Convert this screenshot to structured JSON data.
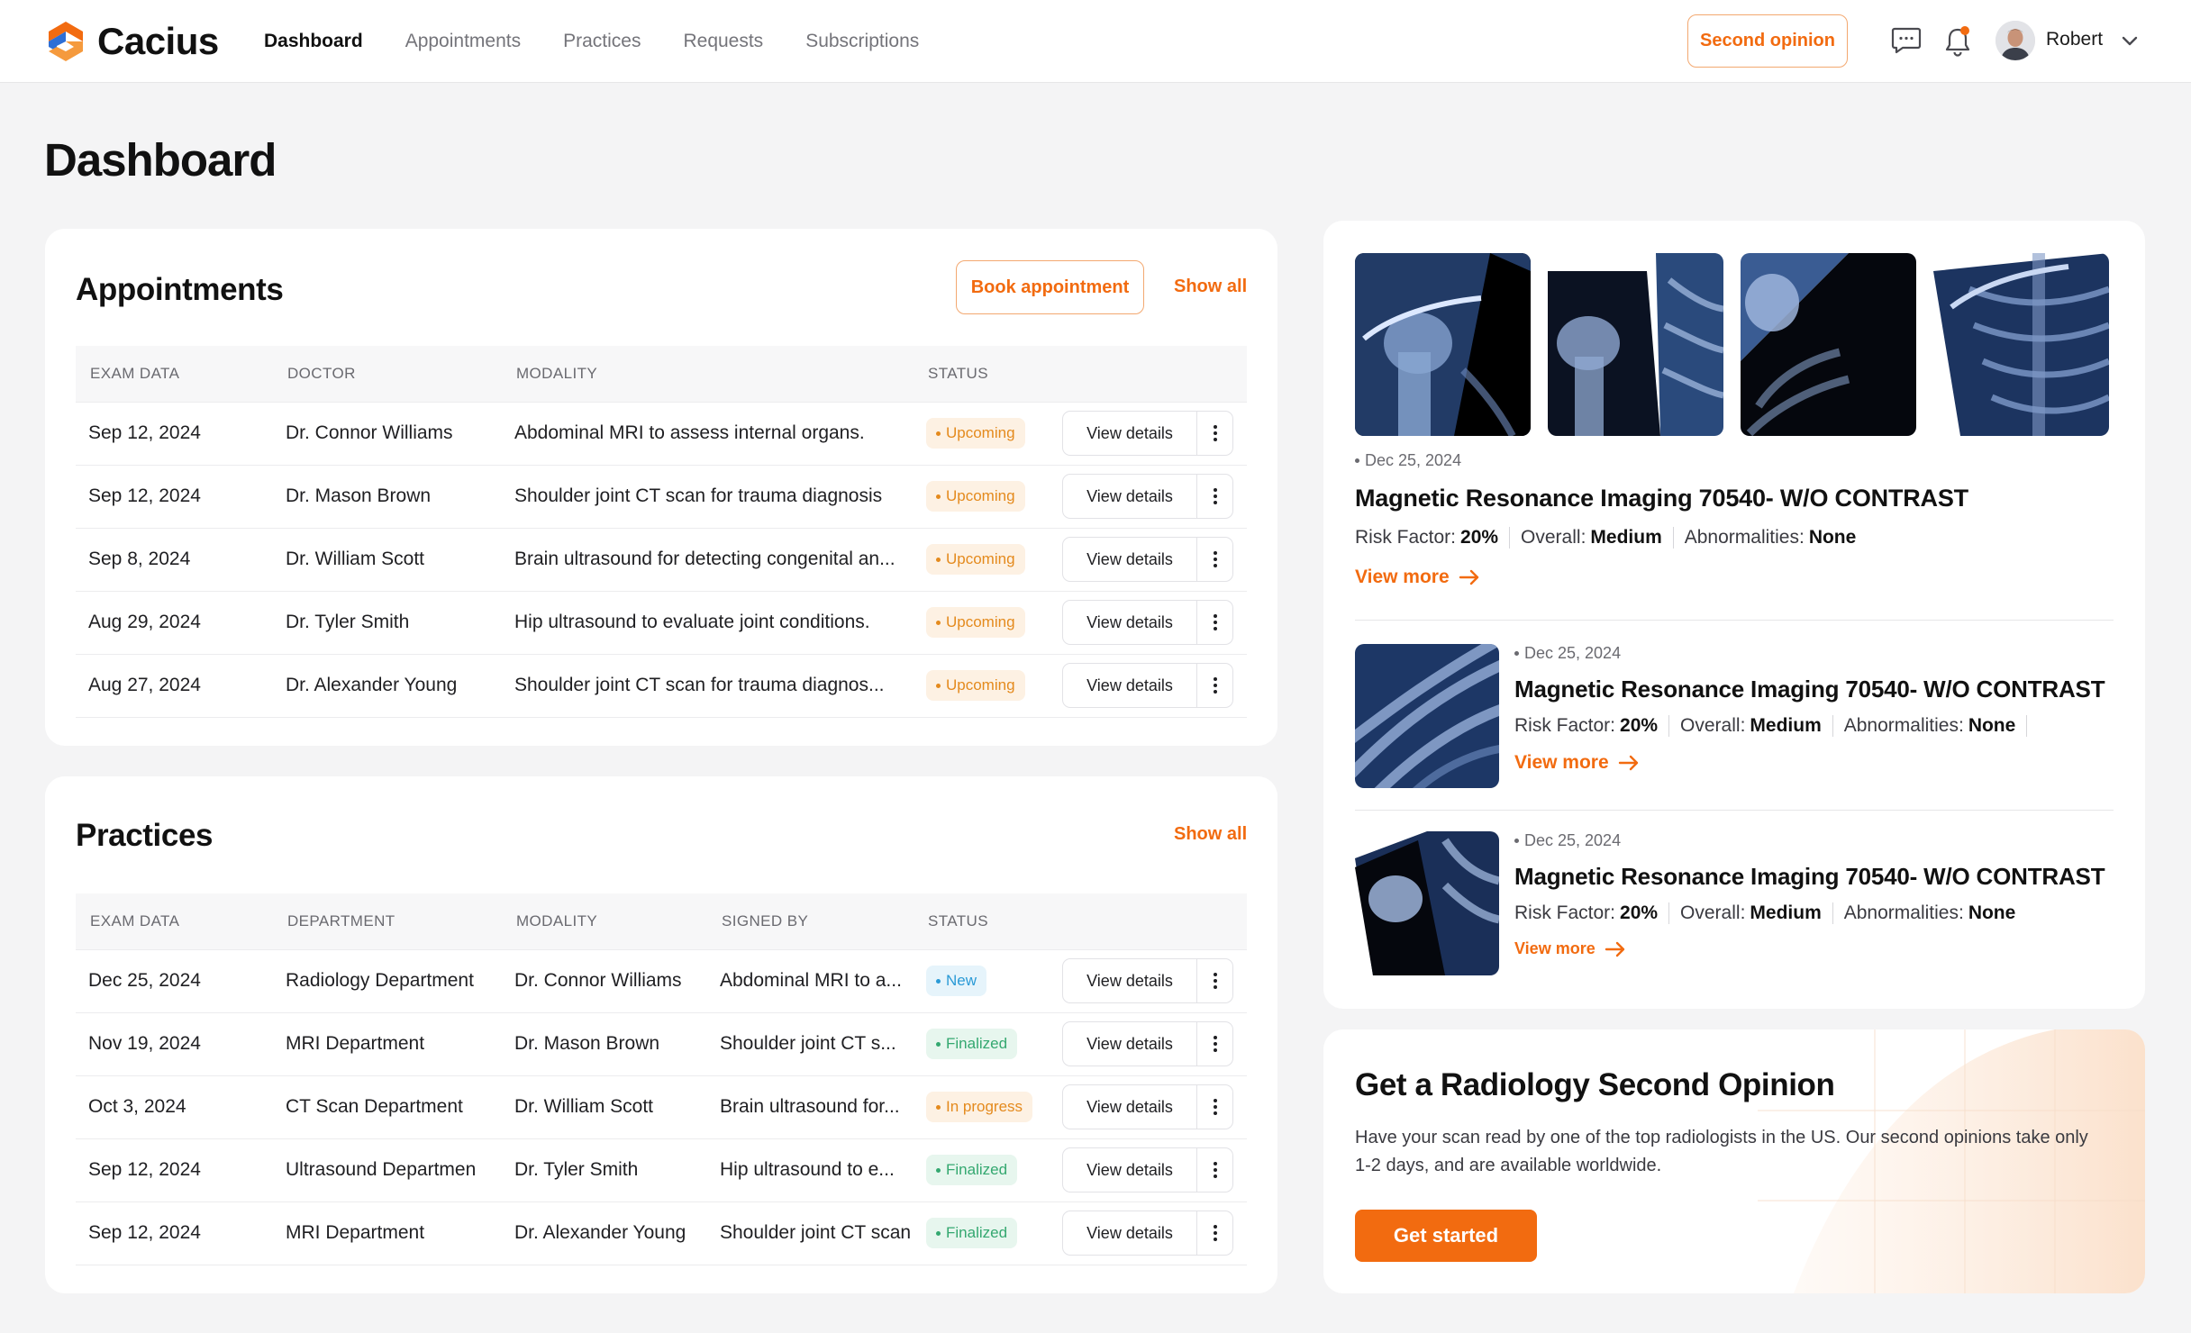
{
  "app": {
    "brand": "Cacius",
    "nav": [
      {
        "label": "Dashboard",
        "active": true
      },
      {
        "label": "Appointments",
        "active": false
      },
      {
        "label": "Practices",
        "active": false
      },
      {
        "label": "Requests",
        "active": false
      },
      {
        "label": "Subscriptions",
        "active": false
      }
    ],
    "second_opinion_label": "Second opinion",
    "user_name": "Robert",
    "icons": {
      "chat": "chat-icon",
      "bell": "bell-icon",
      "chevron": "chevron-down-icon"
    },
    "colors": {
      "accent": "#f26b10",
      "notification": "#f26b10"
    }
  },
  "page_title": "Dashboard",
  "appointments": {
    "title": "Appointments",
    "book_label": "Book appointment",
    "show_all_label": "Show all",
    "columns": [
      "EXAM DATA",
      "DOCTOR",
      "MODALITY",
      "STATUS"
    ],
    "rows": [
      {
        "date": "Sep 12, 2024",
        "doctor": "Dr. Connor Williams",
        "modality": "Abdominal MRI to assess internal organs.",
        "status": "Upcoming"
      },
      {
        "date": "Sep 12, 2024",
        "doctor": "Dr. Mason Brown",
        "modality": "Shoulder joint CT scan for trauma diagnosis",
        "status": "Upcoming"
      },
      {
        "date": "Sep 8, 2024",
        "doctor": "Dr. William Scott",
        "modality": "Brain ultrasound for detecting congenital an...",
        "status": "Upcoming"
      },
      {
        "date": "Aug 29, 2024",
        "doctor": "Dr. Tyler Smith",
        "modality": "Hip ultrasound to evaluate joint conditions.",
        "status": "Upcoming"
      },
      {
        "date": "Aug 27, 2024",
        "doctor": "Dr. Alexander Young",
        "modality": "Shoulder joint CT scan for trauma diagnos...",
        "status": "Upcoming"
      }
    ],
    "view_label": "View details"
  },
  "practices": {
    "title": "Practices",
    "show_all_label": "Show all",
    "columns": [
      "EXAM DATA",
      "DEPARTMENT",
      "MODALITY",
      "SIGNED BY",
      "STATUS"
    ],
    "rows": [
      {
        "date": "Dec 25, 2024",
        "department": "Radiology Department",
        "modality": "Dr. Connor Williams",
        "signed_by": "Abdominal MRI to a...",
        "status": "New"
      },
      {
        "date": "Nov 19, 2024",
        "department": "MRI Department",
        "modality": "Dr. Mason Brown",
        "signed_by": "Shoulder joint CT s...",
        "status": "Finalized"
      },
      {
        "date": "Oct 3, 2024",
        "department": "CT Scan Department",
        "modality": "Dr. William Scott",
        "signed_by": "Brain ultrasound for...",
        "status": "In progress"
      },
      {
        "date": "Sep 12, 2024",
        "department": "Ultrasound Departmen",
        "modality": "Dr. Tyler Smith",
        "signed_by": "Hip ultrasound to e...",
        "status": "Finalized"
      },
      {
        "date": "Sep 12, 2024",
        "department": "MRI Department",
        "modality": "Dr. Alexander Young",
        "signed_by": "Shoulder joint CT scan",
        "status": "Finalized"
      }
    ],
    "view_label": "View details"
  },
  "scans": {
    "featured": {
      "date": "Dec 25, 2024",
      "title": "Magnetic Resonance Imaging 70540- W/O CONTRAST",
      "risk_label": "Risk Factor:",
      "risk_value": "20%",
      "overall_label": "Overall:",
      "overall_value": "Medium",
      "abnormal_label": "Abnormalities:",
      "abnormal_value": "None",
      "view_more_label": "View more"
    },
    "items": [
      {
        "date": "Dec 25, 2024",
        "title": "Magnetic Resonance Imaging 70540- W/O CONTRAST",
        "risk_label": "Risk Factor:",
        "risk_value": "20%",
        "overall_label": "Overall:",
        "overall_value": "Medium",
        "abnormal_label": "Abnormalities:",
        "abnormal_value": "None",
        "view_more_label": "View more"
      },
      {
        "date": "Dec 25, 2024",
        "title": "Magnetic Resonance Imaging 70540- W/O CONTRAST",
        "risk_label": "Risk Factor:",
        "risk_value": "20%",
        "overall_label": "Overall:",
        "overall_value": "Medium",
        "abnormal_label": "Abnormalities:",
        "abnormal_value": "None",
        "view_more_label": "View more"
      }
    ]
  },
  "cta": {
    "title": "Get a Radiology Second Opinion",
    "text": "Have your scan read by one of the top radiologists in the US. Our second opinions take only 1-2 days, and are available worldwide.",
    "button_label": "Get started"
  }
}
